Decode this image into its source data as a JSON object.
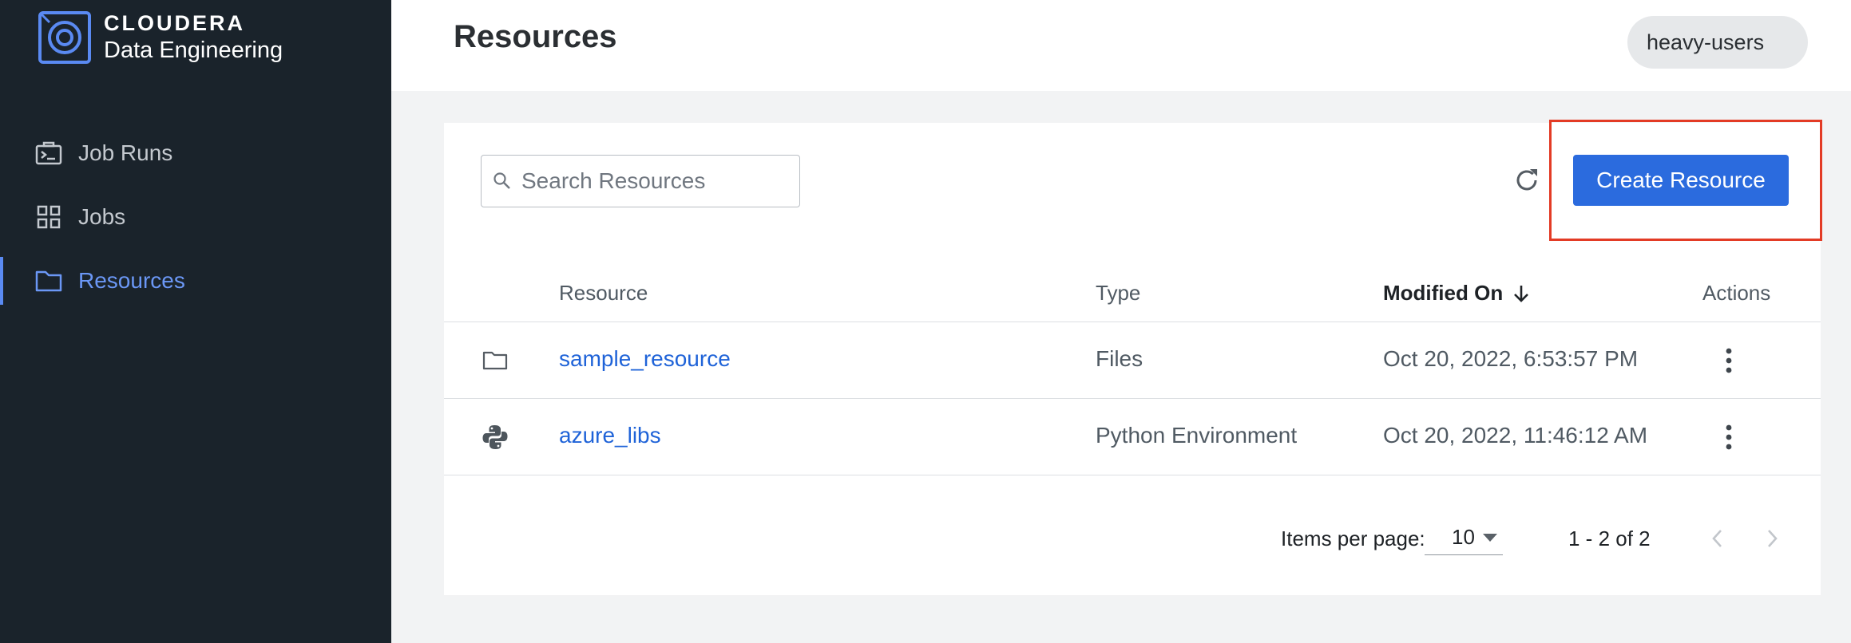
{
  "brand": {
    "company": "CLOUDERA",
    "product": "Data Engineering"
  },
  "sidebar": {
    "items": [
      {
        "label": "Job Runs",
        "icon": "job-runs-icon",
        "active": false
      },
      {
        "label": "Jobs",
        "icon": "jobs-grid-icon",
        "active": false
      },
      {
        "label": "Resources",
        "icon": "folder-icon",
        "active": true
      }
    ]
  },
  "header": {
    "title": "Resources",
    "user": "heavy-users"
  },
  "toolbar": {
    "search_placeholder": "Search Resources",
    "create_label": "Create Resource"
  },
  "table": {
    "columns": {
      "resource": "Resource",
      "type": "Type",
      "modified": "Modified On",
      "actions": "Actions"
    },
    "rows": [
      {
        "icon": "folder-icon",
        "name": "sample_resource",
        "type": "Files",
        "modified": "Oct 20, 2022, 6:53:57 PM"
      },
      {
        "icon": "python-icon",
        "name": "azure_libs",
        "type": "Python Environment",
        "modified": "Oct 20, 2022, 11:46:12 AM"
      }
    ]
  },
  "pagination": {
    "items_label": "Items per page:",
    "per_page": "10",
    "range": "1 - 2 of 2"
  },
  "colors": {
    "sidebar_bg": "#1a232b",
    "accent": "#2b6bde",
    "highlight": "#e33b25",
    "active_nav": "#6b97f5"
  }
}
